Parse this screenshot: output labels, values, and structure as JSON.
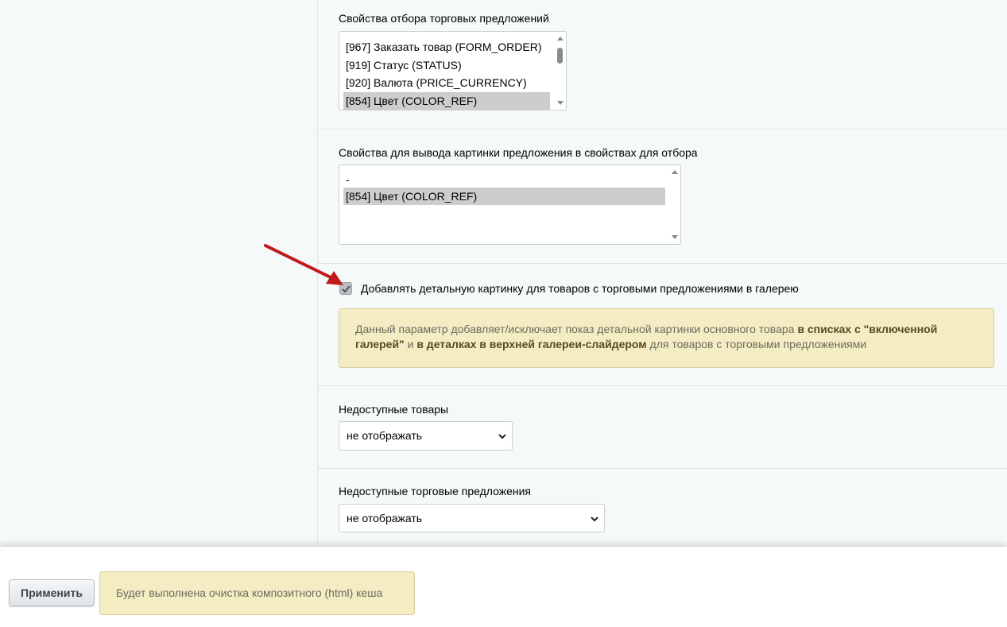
{
  "offer_filter_props": {
    "label": "Свойства отбора торговых предложений",
    "options": [
      {
        "text": "[967] Заказать товар (FORM_ORDER)",
        "selected": false
      },
      {
        "text": "[919] Статус (STATUS)",
        "selected": false
      },
      {
        "text": "[920] Валюта (PRICE_CURRENCY)",
        "selected": false
      },
      {
        "text": "[854] Цвет (COLOR_REF)",
        "selected": true
      }
    ]
  },
  "offer_picture_props": {
    "label": "Свойства для вывода картинки предложения в свойствах для отбора",
    "options": [
      {
        "text": "-",
        "selected": false
      },
      {
        "text": "[854] Цвет (COLOR_REF)",
        "selected": true
      }
    ]
  },
  "gallery_checkbox": {
    "label": "Добавлять детальную картинку для товаров с торговыми предложениями в галерею",
    "checked": true
  },
  "gallery_notice": {
    "part1": "Данный параметр добавляет/исключает показ детальной картинки основного товара ",
    "bold1": "в списках с \"включенной галерей\"",
    "part2": " и ",
    "bold2": "в деталках в верхней галереи-слайдером",
    "part3": " для товаров с торговыми предложениями"
  },
  "unavailable_goods": {
    "label": "Недоступные товары",
    "value": "не отображать"
  },
  "unavailable_offers": {
    "label": "Недоступные торговые предложения",
    "value": "не отображать"
  },
  "footer": {
    "apply_label": "Применить",
    "note": "Будет выполнена очистка композитного (html) кеша"
  },
  "colors": {
    "annotation_arrow": "#c0181b",
    "notice_bg": "#f4edc3",
    "selected_option_bg": "#cdcdcd"
  }
}
